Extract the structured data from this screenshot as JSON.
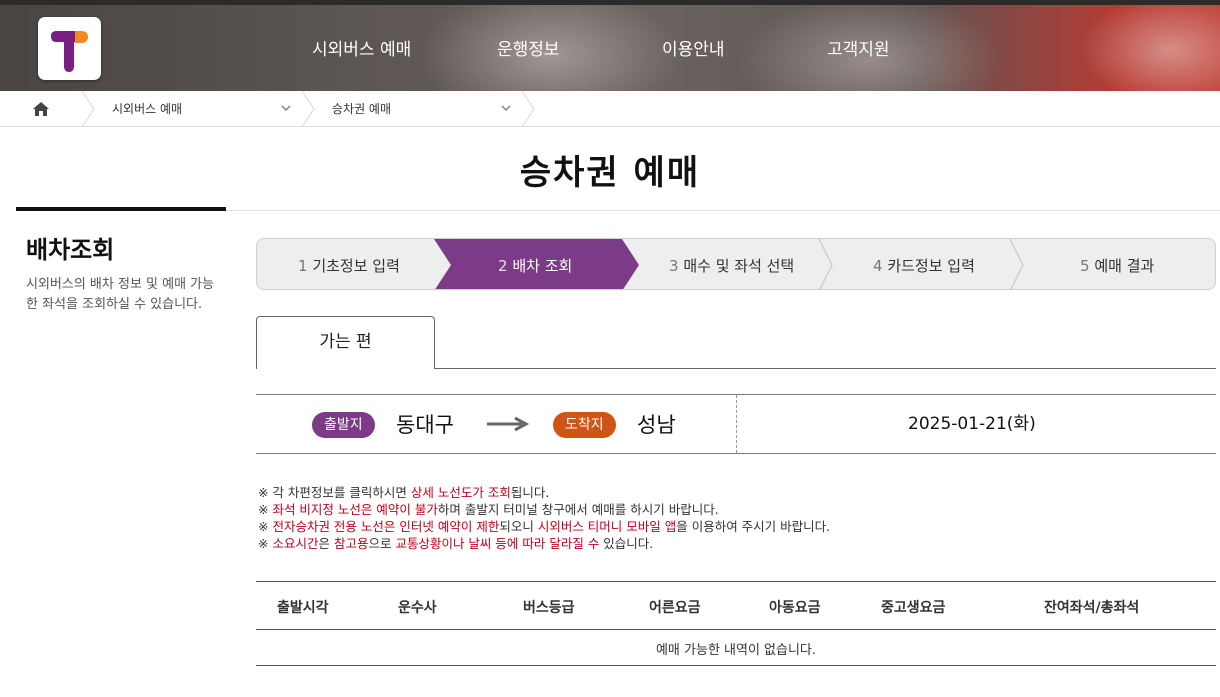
{
  "header": {
    "nav": [
      "시외버스 예매",
      "운행정보",
      "이용안내",
      "고객지원"
    ],
    "colors": {
      "logo_purple": "#7b1e84",
      "logo_orange": "#f28b1f"
    }
  },
  "breadcrumb": {
    "home_icon": "home-icon",
    "items": [
      "시외버스 예매",
      "승차권 예매"
    ]
  },
  "page": {
    "title": "승차권 예매"
  },
  "sidebar": {
    "title": "배차조회",
    "description": "시외버스의 배차 정보 및 예매 가능한 좌석을 조회하실 수 있습니다."
  },
  "steps": [
    {
      "num": "1",
      "label": "기초정보 입력"
    },
    {
      "num": "2",
      "label": "배차 조회",
      "active": true
    },
    {
      "num": "3",
      "label": "매수 및 좌석 선택"
    },
    {
      "num": "4",
      "label": "카드정보 입력"
    },
    {
      "num": "5",
      "label": "예매 결과"
    }
  ],
  "active_step_color": "#7b3b86",
  "tab": {
    "label": "가는 편"
  },
  "route": {
    "departure_label": "출발지",
    "departure": "동대구",
    "arrival_label": "도착지",
    "arrival": "성남",
    "date": "2025-01-21(화)"
  },
  "notes": [
    {
      "mark": "※",
      "parts": [
        [
          "각 차편정보를 클릭하시면 ",
          false
        ],
        [
          "상세 노선도가 조회",
          true
        ],
        [
          "됩니다.",
          false
        ]
      ]
    },
    {
      "mark": "※",
      "parts": [
        [
          "좌석 비지정 노선은 예약이 불가",
          true
        ],
        [
          "하며 출발지 터미널 창구에서 예매를 하시기 바랍니다.",
          false
        ]
      ]
    },
    {
      "mark": "※",
      "parts": [
        [
          "전자승차권 전용 노선은 인터넷 예약이 제한",
          true
        ],
        [
          "되오니 ",
          false
        ],
        [
          "시외버스 티머니 모바일 앱",
          true
        ],
        [
          "을 이용하여 주시기 바랍니다.",
          false
        ]
      ]
    },
    {
      "mark": "※",
      "parts": [
        [
          "소요시간",
          true
        ],
        [
          "은 ",
          false
        ],
        [
          "참고용",
          true
        ],
        [
          "으로 ",
          false
        ],
        [
          "교통상황이나 날씨 등에 따라 달라질 수",
          true
        ],
        [
          " 있습니다.",
          false
        ]
      ]
    }
  ],
  "table": {
    "columns": [
      "출발시각",
      "운수사",
      "버스등급",
      "어른요금",
      "아동요금",
      "중고생요금",
      "잔여좌석/총좌석"
    ],
    "empty_message": "예매 가능한 내역이 없습니다."
  }
}
